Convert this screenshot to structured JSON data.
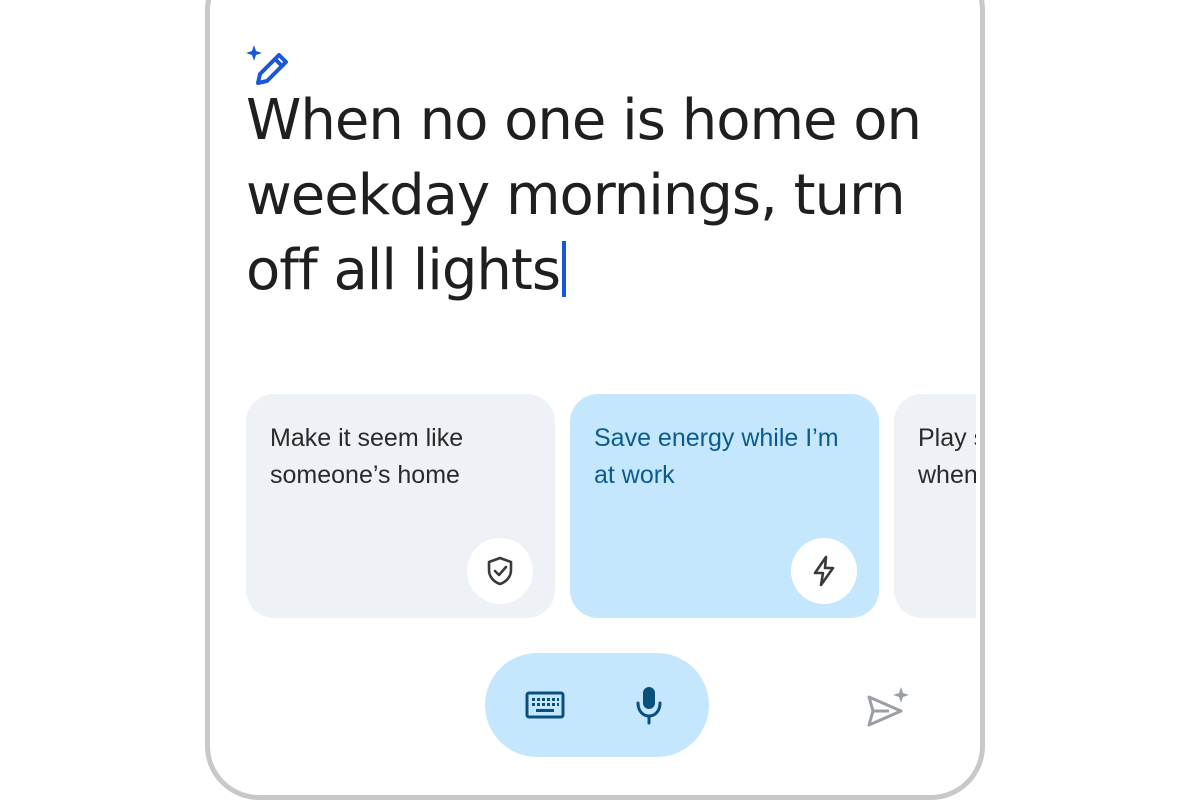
{
  "prompt": {
    "text": "When no one is home on weekday mornings, turn off all lights"
  },
  "suggestions": [
    {
      "label": "Make it seem like someone’s home",
      "icon": "shield-check-icon",
      "selected": false
    },
    {
      "label": "Save energy while I’m at work",
      "icon": "lightning-bolt-icon",
      "selected": true
    },
    {
      "label": "Play s when",
      "icon": "",
      "selected": false
    }
  ],
  "colors": {
    "accent": "#1a56db",
    "selected_card": "#c4e7fd",
    "card": "#eef2f7",
    "selected_text": "#0b5b8f"
  },
  "icons": {
    "header": "magic-pen-icon",
    "keyboard": "keyboard-icon",
    "microphone": "microphone-icon",
    "send": "sparkle-send-icon"
  }
}
